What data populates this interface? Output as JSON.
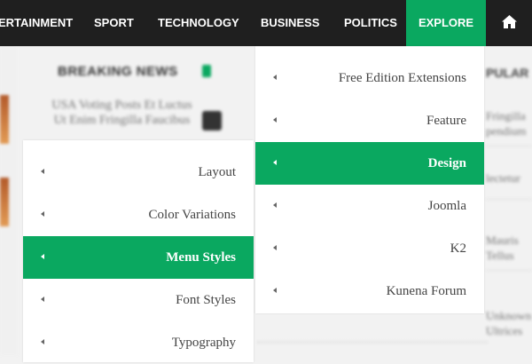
{
  "nav": {
    "items": [
      "ERTAINMENT",
      "SPORT",
      "TECHNOLOGY",
      "BUSINESS",
      "POLITICS",
      "EXPLORE"
    ],
    "home_icon": "home-icon",
    "accent": "#0aa860"
  },
  "background": {
    "breaking_news_title": "BREAKING NEWS",
    "story_text": "USA Voting Posts Et Luctus Ut Enim Fringilla Faucibus",
    "popular_title": "PULAR",
    "popular_items": [
      "Fringilla pendium",
      "lectetur",
      "Mauris Tellus",
      "Unknown Ultrices"
    ]
  },
  "explore_menu": {
    "items": [
      "Free Edition Extensions",
      "Feature",
      "Design",
      "Joomla",
      "K2",
      "Kunena Forum"
    ],
    "active": "Design"
  },
  "design_submenu": {
    "items": [
      "Layout",
      "Color Variations",
      "Menu Styles",
      "Font Styles",
      "Typography"
    ],
    "active": "Menu Styles"
  }
}
